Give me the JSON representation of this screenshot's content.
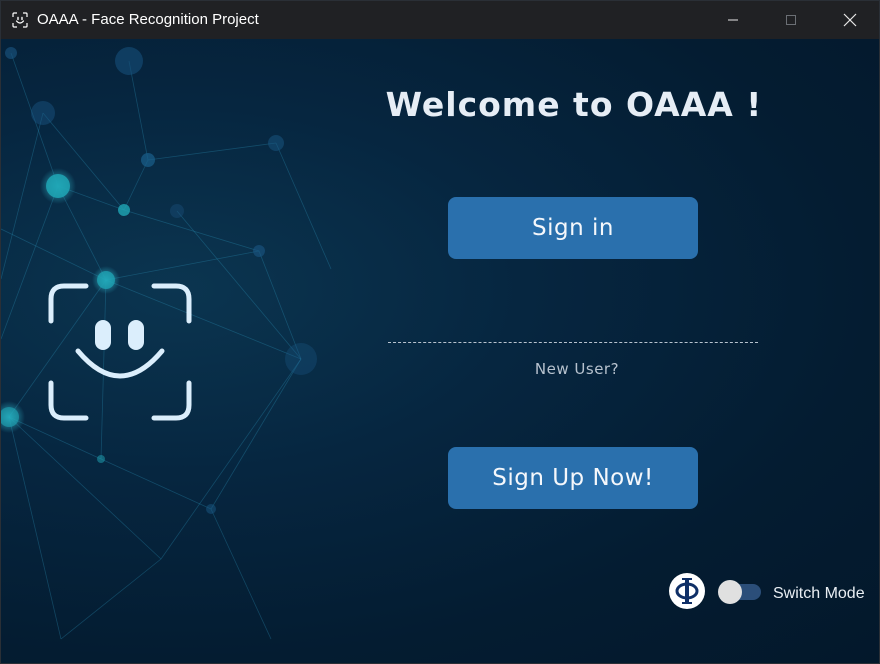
{
  "window": {
    "title": "OAAA - Face Recognition Project",
    "icon": "smiley-face-icon",
    "controls": [
      "minimize-icon",
      "maximize-icon",
      "close-icon"
    ]
  },
  "main": {
    "heading": "Welcome to OAAA !",
    "sign_in_label": "Sign in",
    "new_user_prompt": "New User?",
    "sign_up_label": "Sign Up Now!"
  },
  "footer": {
    "logo_icon": "phi-logo-icon",
    "switch_label": "Switch Mode",
    "switch_on": false
  },
  "colors": {
    "background": "#031a2e",
    "button": "#2a70ad",
    "titlebar": "#202124",
    "toggle_track": "#2b4e79"
  }
}
